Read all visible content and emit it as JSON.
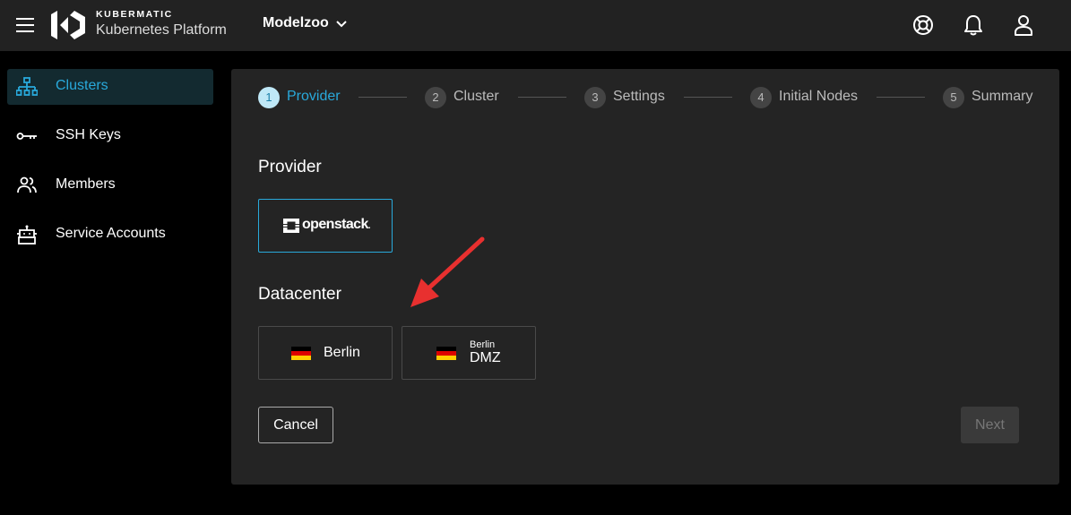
{
  "topbar": {
    "brand_top": "KUBERMATIC",
    "brand_bottom": "Kubernetes Platform",
    "project": "Modelzoo",
    "icons": [
      "menu-icon",
      "chevron-down-icon",
      "help-icon",
      "bell-icon",
      "user-icon"
    ]
  },
  "sidebar": {
    "items": [
      {
        "label": "Clusters",
        "icon": "sitemap-icon",
        "active": true
      },
      {
        "label": "SSH Keys",
        "icon": "key-icon",
        "active": false
      },
      {
        "label": "Members",
        "icon": "users-icon",
        "active": false
      },
      {
        "label": "Service Accounts",
        "icon": "robot-icon",
        "active": false
      }
    ]
  },
  "stepper": {
    "steps": [
      {
        "num": "1",
        "label": "Provider",
        "active": true
      },
      {
        "num": "2",
        "label": "Cluster",
        "active": false
      },
      {
        "num": "3",
        "label": "Settings",
        "active": false
      },
      {
        "num": "4",
        "label": "Initial Nodes",
        "active": false
      },
      {
        "num": "5",
        "label": "Summary",
        "active": false
      }
    ]
  },
  "provider": {
    "title": "Provider",
    "options": [
      {
        "label": "openstack",
        "mark": ".",
        "selected": true
      }
    ]
  },
  "datacenter": {
    "title": "Datacenter",
    "options": [
      {
        "label": "Berlin",
        "sublabel": "",
        "flag": "DE"
      },
      {
        "label": "DMZ",
        "sublabel": "Berlin",
        "flag": "DE"
      }
    ]
  },
  "actions": {
    "cancel": "Cancel",
    "next": "Next"
  },
  "colors": {
    "accent": "#29a9db",
    "annotation_arrow": "#e8302f"
  }
}
